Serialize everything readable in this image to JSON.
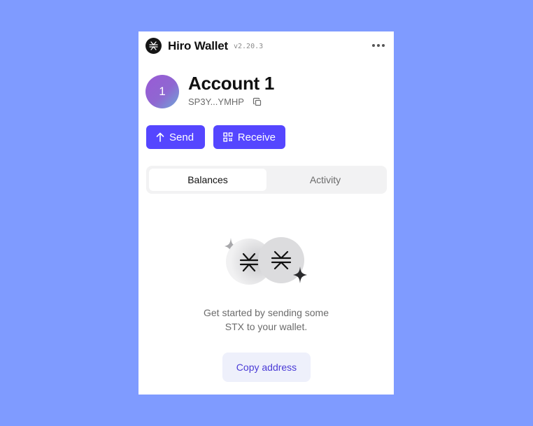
{
  "header": {
    "app_title": "Hiro Wallet",
    "version": "v2.20.3",
    "logo_icon": "stacks-logo-icon",
    "menu_icon": "more-horizontal-icon"
  },
  "account": {
    "avatar_initial": "1",
    "name": "Account 1",
    "address": "SP3Y...YMHP",
    "copy_icon": "copy-icon"
  },
  "actions": {
    "send_label": "Send",
    "send_icon": "arrow-up-icon",
    "receive_label": "Receive",
    "receive_icon": "qr-code-icon"
  },
  "tabs": [
    {
      "label": "Balances",
      "active": true
    },
    {
      "label": "Activity",
      "active": false
    }
  ],
  "empty_state": {
    "line1": "Get started by sending some",
    "line2": "STX to your wallet.",
    "copy_button_label": "Copy address"
  },
  "colors": {
    "background": "#7f9bff",
    "accent": "#5546ff",
    "copy_button_bg": "#eef0fb",
    "copy_button_text": "#4a3bd6"
  }
}
